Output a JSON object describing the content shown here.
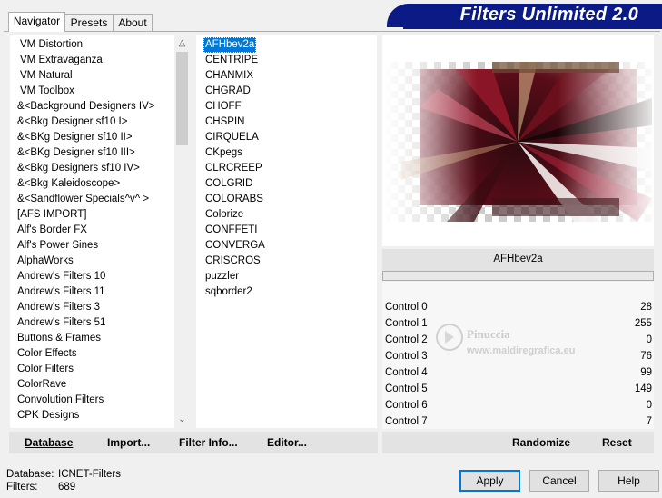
{
  "tabs": [
    {
      "label": "Navigator"
    },
    {
      "label": "Presets"
    },
    {
      "label": "About"
    }
  ],
  "banner": {
    "title": "Filters Unlimited 2.0"
  },
  "categories": [
    "VM Distortion",
    "VM Extravaganza",
    "VM Natural",
    "VM Toolbox",
    "&<Background Designers IV>",
    "&<Bkg Designer sf10 I>",
    "&<BKg Designer sf10 II>",
    "&<BKg Designer sf10 III>",
    "&<Bkg Designers sf10 IV>",
    "&<Bkg Kaleidoscope>",
    "&<Sandflower Specials^v^ >",
    "[AFS IMPORT]",
    "Alf's Border FX",
    "Alf's Power Sines",
    "AlphaWorks",
    "Andrew's Filters 10",
    "Andrew's Filters 11",
    "Andrew's Filters 3",
    "Andrew's Filters 51",
    "Buttons & Frames",
    "Color Effects",
    "Color Filters",
    "ColorRave",
    "Convolution Filters",
    "CPK Designs"
  ],
  "filters": [
    "AFHbev2a",
    "CENTRIPE",
    "CHANMIX",
    "CHGRAD",
    "CHOFF",
    "CHSPIN",
    "CIRQUELA",
    "CKpegs",
    "CLRCREEP",
    "COLGRID",
    "COLORABS",
    "Colorize",
    "CONFFETI",
    "CONVERGA",
    "CRISCROS",
    "puzzler",
    "sqborder2"
  ],
  "selected_filter": "AFHbev2a",
  "filter_name_display": "AFHbev2a",
  "controls": [
    {
      "label": "Control 0",
      "value": "28"
    },
    {
      "label": "Control 1",
      "value": "255"
    },
    {
      "label": "Control 2",
      "value": "0"
    },
    {
      "label": "Control 3",
      "value": "76"
    },
    {
      "label": "Control 4",
      "value": "99"
    },
    {
      "label": "Control 5",
      "value": "149"
    },
    {
      "label": "Control 6",
      "value": "0"
    },
    {
      "label": "Control 7",
      "value": "7"
    }
  ],
  "watermark": {
    "line1": "Pinuccia",
    "line2": "www.maldiregrafica.eu"
  },
  "toolbar": {
    "database": "Database",
    "import": "Import...",
    "filter_info": "Filter Info...",
    "editor": "Editor...",
    "randomize": "Randomize",
    "reset": "Reset"
  },
  "status": {
    "database_label": "Database:",
    "database_value": "ICNET-Filters",
    "filters_label": "Filters:",
    "filters_value": "689"
  },
  "buttons": {
    "apply": "Apply",
    "cancel": "Cancel",
    "help": "Help"
  },
  "icons": {
    "scroll_up": "chevron-up-icon",
    "scroll_down": "chevron-down-icon"
  }
}
